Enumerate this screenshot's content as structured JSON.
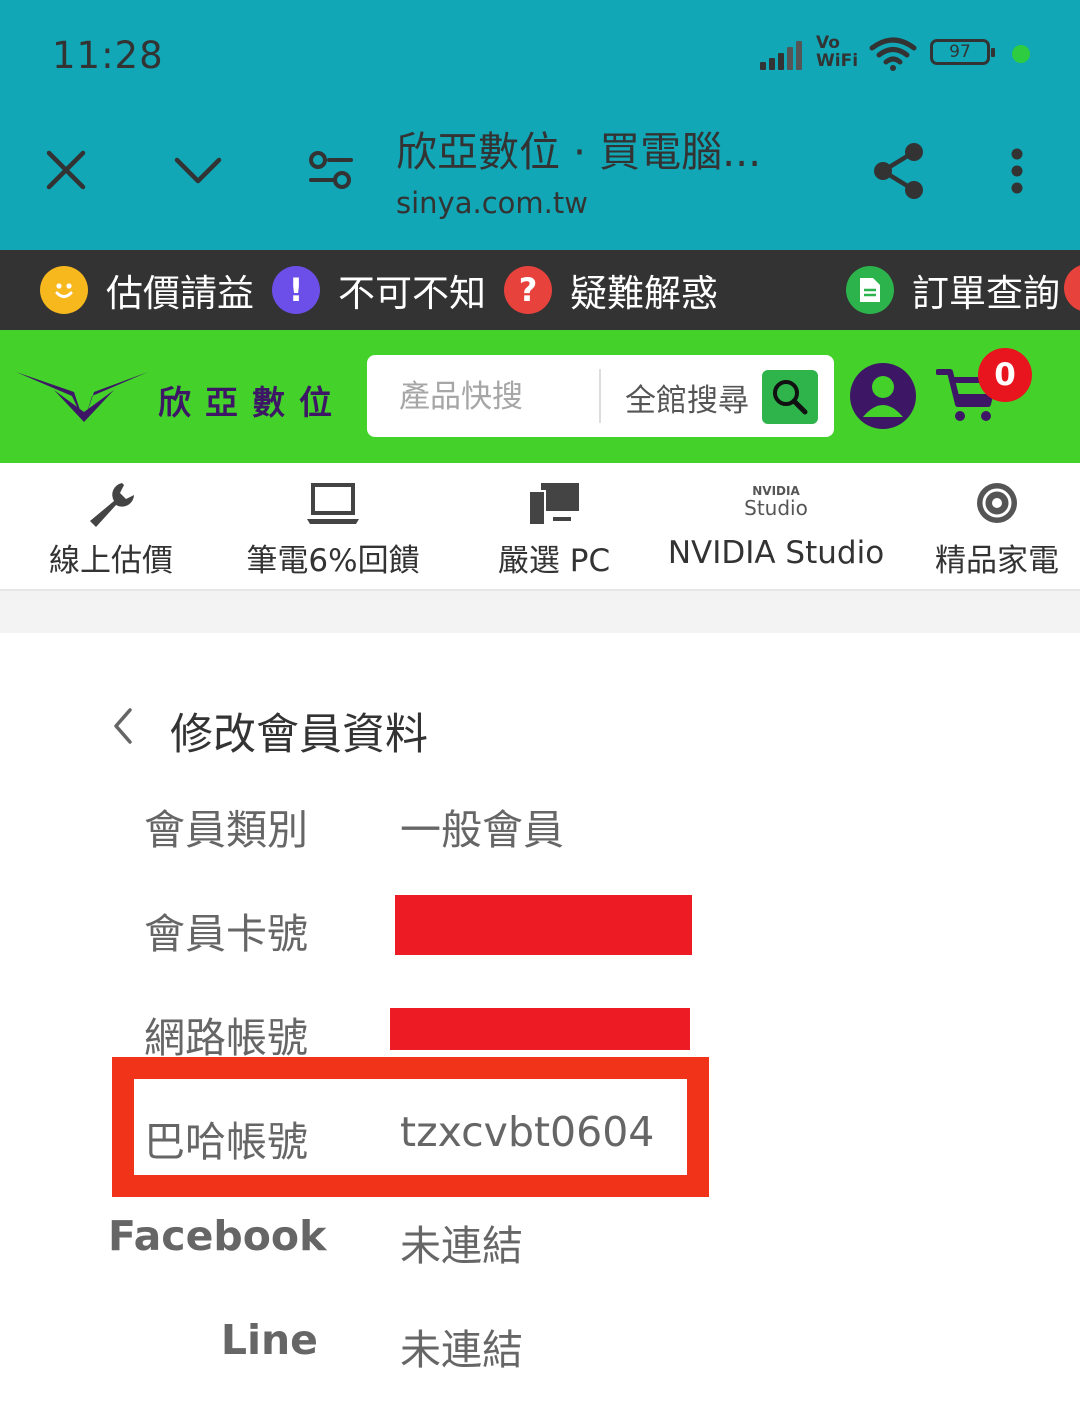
{
  "status_bar": {
    "time": "11:28",
    "network": "Vo WiFi",
    "battery": "97"
  },
  "browser": {
    "title": "欣亞數位 · 買電腦...",
    "url": "sinya.com.tw"
  },
  "topbar": {
    "items": [
      {
        "label": "估價請益",
        "icon": "smiley-icon",
        "glyph": "☺",
        "color": "#f6b81c"
      },
      {
        "label": "不可不知",
        "icon": "exclamation-icon",
        "glyph": "!",
        "color": "#6c4ee8"
      },
      {
        "label": "疑難解惑",
        "icon": "question-icon",
        "glyph": "?",
        "color": "#e8423d"
      },
      {
        "label": "訂單查詢",
        "icon": "document-icon",
        "glyph": "",
        "color": "#2cb34b"
      }
    ]
  },
  "header": {
    "logo_text": "欣亞數位",
    "search_placeholder": "產品快搜",
    "search_scope": "全館搜尋",
    "cart_count": "0",
    "colors": {
      "brand_green": "#43d12a",
      "brand_purple": "#3d1766"
    }
  },
  "categories": [
    {
      "label": "線上估價",
      "icon": "wrench-icon"
    },
    {
      "label": "筆電6%回饋",
      "icon": "laptop-icon"
    },
    {
      "label": "嚴選 PC",
      "icon": "desktop-pc-icon"
    },
    {
      "label": "NVIDIA Studio",
      "icon": "nvidia-studio-icon",
      "logo_brand": "NVIDIA",
      "logo_sub": "Studio"
    },
    {
      "label": "精品家電",
      "icon": "speaker-icon"
    }
  ],
  "form": {
    "title": "修改會員資料",
    "rows": [
      {
        "label": "會員類別",
        "value": "一般會員"
      },
      {
        "label": "會員卡號",
        "value": ""
      },
      {
        "label": "網路帳號",
        "value": ""
      },
      {
        "label": "巴哈帳號",
        "value": "tzxcvbt0604"
      },
      {
        "label": "Facebook",
        "value": "未連結"
      },
      {
        "label": "Line",
        "value": "未連結"
      }
    ]
  }
}
